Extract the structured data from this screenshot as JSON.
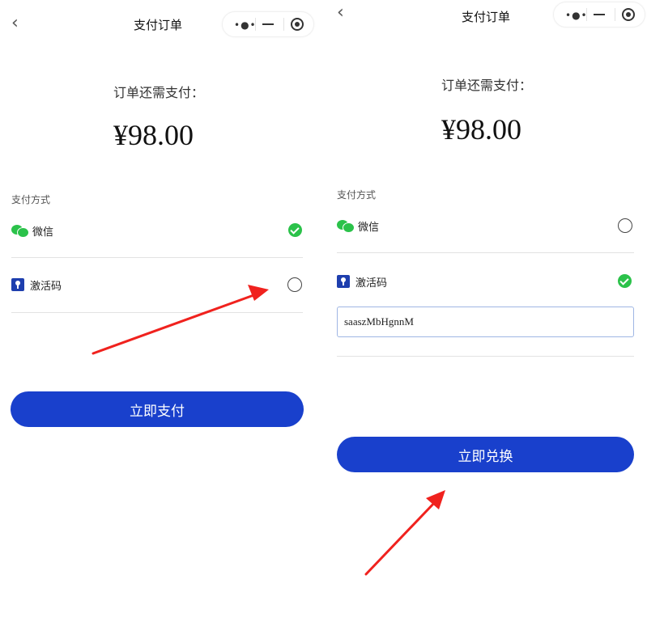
{
  "left": {
    "nav": {
      "back_icon": "chevron-left-icon",
      "title": "支付订单"
    },
    "capsule": {
      "more_icon": "more-dots-icon",
      "minimize_icon": "minimize-icon",
      "close_icon": "target-icon"
    },
    "order": {
      "need_pay_label": "订单还需支付：",
      "amount": "¥98.00"
    },
    "payment": {
      "section_label": "支付方式",
      "methods": [
        {
          "label": "微信",
          "icon": "wechat-icon",
          "selected": true
        },
        {
          "label": "激活码",
          "icon": "key-icon",
          "selected": false
        }
      ]
    },
    "submit_label": "立即支付"
  },
  "right": {
    "nav": {
      "back_icon": "chevron-left-icon",
      "title": "支付订单"
    },
    "capsule": {
      "more_icon": "more-dots-icon",
      "minimize_icon": "minimize-icon",
      "close_icon": "target-icon"
    },
    "order": {
      "need_pay_label": "订单还需支付：",
      "amount": "¥98.00"
    },
    "payment": {
      "section_label": "支付方式",
      "methods": [
        {
          "label": "微信",
          "icon": "wechat-icon",
          "selected": false
        },
        {
          "label": "激活码",
          "icon": "key-icon",
          "selected": true
        }
      ]
    },
    "activation_code_value": "saaszMbHgnnM",
    "submit_label": "立即兑换"
  },
  "colors": {
    "primary_button": "#1940cc",
    "check_green": "#2bc24a",
    "arrow_red": "#f0221e"
  }
}
